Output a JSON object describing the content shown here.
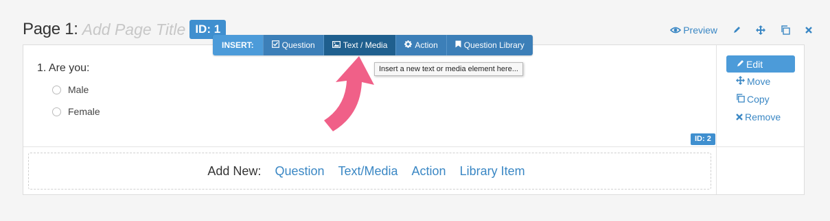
{
  "page": {
    "label": "Page 1:",
    "title_placeholder": "Add Page Title",
    "id_badge": "ID: 1"
  },
  "page_actions": {
    "preview_label": "Preview",
    "icons": [
      "eye-icon",
      "pencil-icon",
      "move-icon",
      "copy-icon",
      "close-icon"
    ]
  },
  "insert_bar": {
    "label": "INSERT:",
    "buttons": [
      {
        "label": "Question",
        "icon": "checkbox-icon"
      },
      {
        "label": "Text / Media",
        "icon": "image-icon"
      },
      {
        "label": "Action",
        "icon": "gear-icon"
      },
      {
        "label": "Question Library",
        "icon": "bookmark-icon"
      }
    ],
    "active": "Text / Media"
  },
  "tooltip": "Insert a new text or media element here...",
  "question": {
    "text": "1. Are you:",
    "choices": [
      "Male",
      "Female"
    ],
    "id_badge": "ID: 2"
  },
  "question_actions": {
    "edit": "Edit",
    "move": "Move",
    "copy": "Copy",
    "remove": "Remove"
  },
  "add_new": {
    "label": "Add New:",
    "links": [
      "Question",
      "Text/Media",
      "Action",
      "Library Item"
    ]
  },
  "colors": {
    "accent": "#3f8fcf",
    "link": "#3a87c4",
    "insert_dark": "#3c7fb8",
    "insert_active": "#1f5f8e",
    "arrow": "#f06088"
  }
}
